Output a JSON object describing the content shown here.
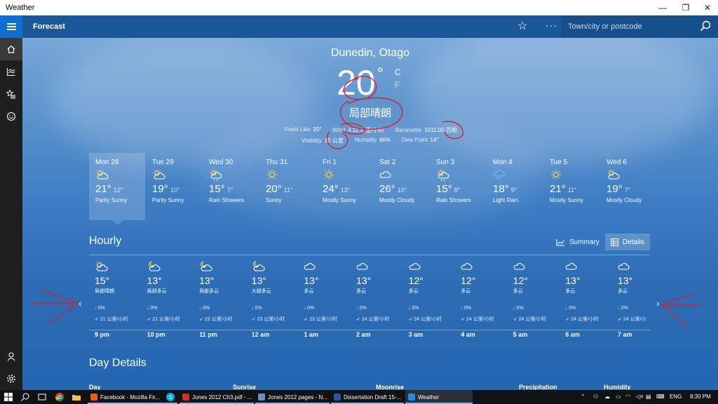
{
  "window": {
    "title": "Weather",
    "minimize": "—",
    "restore": "❐",
    "close": "✕"
  },
  "appbar": {
    "section": "Forecast",
    "search_placeholder": "Town/city or postcode"
  },
  "current": {
    "location": "Dunedin, Otago",
    "temp": "20",
    "deg": "°",
    "unit_c": "C",
    "unit_f": "F",
    "condition": "局部晴朗",
    "feels_like_label": "Feels Like",
    "feels_like": "20°",
    "wind_label": "Wind",
    "wind": "4 11 公里/小时",
    "barometer_label": "Barometer",
    "barometer": "1011.00 百帕",
    "visibility_label": "Visibility",
    "visibility": "10 公里",
    "humidity_label": "Humidity",
    "humidity": "66%",
    "dewpoint_label": "Dew Point",
    "dewpoint": "14°"
  },
  "daily": [
    {
      "day": "Mon 28",
      "high": "21°",
      "low": "12°",
      "cond": "Partly Sunny",
      "icon": "partly-sunny"
    },
    {
      "day": "Tue 29",
      "high": "19°",
      "low": "10°",
      "cond": "Partly Sunny",
      "icon": "partly-sunny"
    },
    {
      "day": "Wed 30",
      "high": "15°",
      "low": "7°",
      "cond": "Rain Showers",
      "icon": "rain-showers"
    },
    {
      "day": "Thu 31",
      "high": "20°",
      "low": "11°",
      "cond": "Sunny",
      "icon": "sunny"
    },
    {
      "day": "Fri 1",
      "high": "24°",
      "low": "13°",
      "cond": "Mostly Sunny",
      "icon": "sunny"
    },
    {
      "day": "Sat 2",
      "high": "26°",
      "low": "10°",
      "cond": "Mostly Cloudy",
      "icon": "cloudy"
    },
    {
      "day": "Sun 3",
      "high": "15°",
      "low": "8°",
      "cond": "Rain Showers",
      "icon": "rain-showers"
    },
    {
      "day": "Mon 4",
      "high": "18°",
      "low": "9°",
      "cond": "Light Rain",
      "icon": "light-rain"
    },
    {
      "day": "Tue 5",
      "high": "21°",
      "low": "11°",
      "cond": "Mostly Sunny",
      "icon": "sunny"
    },
    {
      "day": "Wed 6",
      "high": "19°",
      "low": "7°",
      "cond": "Mostly Cloudy",
      "icon": "partly-sunny"
    }
  ],
  "hourly_section": {
    "title": "Hourly",
    "summary": "Summary",
    "details": "Details"
  },
  "hourly": [
    {
      "temp": "15°",
      "cond": "局部晴朗",
      "precip": "0%",
      "wind": "21 公里/小时",
      "time": "9 pm",
      "icon": "partly-sunny"
    },
    {
      "temp": "13°",
      "cond": "局部多云",
      "precip": "0%",
      "wind": "21 公里/小时",
      "time": "10 pm",
      "icon": "partly-cloudy-night"
    },
    {
      "temp": "13°",
      "cond": "局部多云",
      "precip": "0%",
      "wind": "22 公里/小时",
      "time": "11 pm",
      "icon": "partly-cloudy-night"
    },
    {
      "temp": "13°",
      "cond": "大部多云",
      "precip": "0%",
      "wind": "23 公里/小时",
      "time": "12 am",
      "icon": "partly-cloudy-night"
    },
    {
      "temp": "13°",
      "cond": "多云",
      "precip": "0%",
      "wind": "23 公里/小时",
      "time": "1 am",
      "icon": "cloudy"
    },
    {
      "temp": "13°",
      "cond": "多云",
      "precip": "0%",
      "wind": "24 公里/小时",
      "time": "2 am",
      "icon": "cloudy"
    },
    {
      "temp": "12°",
      "cond": "多云",
      "precip": "0%",
      "wind": "24 公里/小时",
      "time": "3 am",
      "icon": "cloudy"
    },
    {
      "temp": "12°",
      "cond": "多云",
      "precip": "0%",
      "wind": "24 公里/小时",
      "time": "4 am",
      "icon": "cloudy"
    },
    {
      "temp": "12°",
      "cond": "多云",
      "precip": "0%",
      "wind": "24 公里/小时",
      "time": "5 am",
      "icon": "cloudy"
    },
    {
      "temp": "13°",
      "cond": "多云",
      "precip": "0%",
      "wind": "24 公里/小时",
      "time": "6 am",
      "icon": "cloudy"
    },
    {
      "temp": "13°",
      "cond": "多云",
      "precip": "0%",
      "wind": "24 公里/小",
      "time": "7 am",
      "icon": "cloudy"
    }
  ],
  "day_details": {
    "title": "Day Details",
    "day": "Day",
    "sunrise": "Sunrise",
    "moonrise": "Moonrise",
    "precipitation": "Precipitation",
    "humidity": "Humidity"
  },
  "taskbar": {
    "apps": [
      {
        "label": "Facebook - Mozilla Fir...",
        "color": "#e66000"
      },
      {
        "label": "Jones 2012 Ch3.pdf - ...",
        "color": "#d32f2f"
      },
      {
        "label": "Jones 2012 pages - N...",
        "color": "#6a8fbf"
      },
      {
        "label": "Dissertation Draft 15-...",
        "color": "#2b579a"
      },
      {
        "label": "Weather",
        "color": "#2b88d8"
      }
    ],
    "lang": "ENG",
    "time": "8:30 PM"
  }
}
